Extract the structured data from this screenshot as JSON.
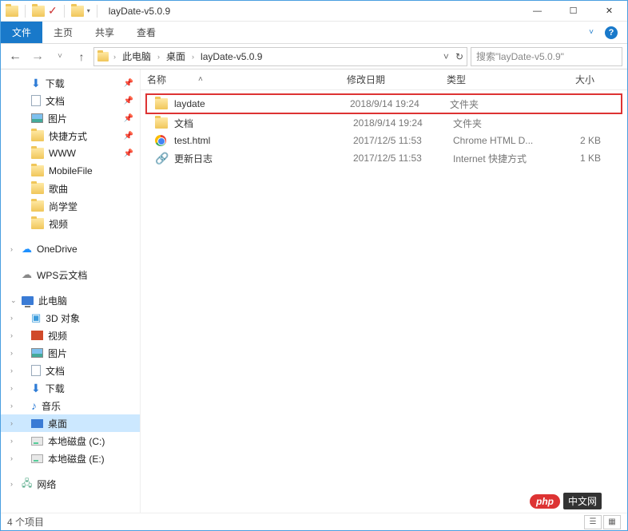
{
  "window": {
    "title": "layDate-v5.0.9"
  },
  "ribbon": {
    "file": "文件",
    "home": "主页",
    "share": "共享",
    "view": "查看"
  },
  "breadcrumb": {
    "pc": "此电脑",
    "desktop": "桌面",
    "folder": "layDate-v5.0.9"
  },
  "search": {
    "placeholder": "搜索\"layDate-v5.0.9\""
  },
  "columns": {
    "name": "名称",
    "date": "修改日期",
    "type": "类型",
    "size": "大小"
  },
  "files": [
    {
      "name": "laydate",
      "date": "2018/9/14 19:24",
      "type": "文件夹",
      "size": "",
      "icon": "folder",
      "highlight": true
    },
    {
      "name": "文档",
      "date": "2018/9/14 19:24",
      "type": "文件夹",
      "size": "",
      "icon": "folder"
    },
    {
      "name": "test.html",
      "date": "2017/12/5 11:53",
      "type": "Chrome HTML D...",
      "size": "2 KB",
      "icon": "chrome"
    },
    {
      "name": "更新日志",
      "date": "2017/12/5 11:53",
      "type": "Internet 快捷方式",
      "size": "1 KB",
      "icon": "link"
    }
  ],
  "sidebar": {
    "downloads": "下载",
    "documents": "文档",
    "pictures": "图片",
    "shortcuts": "快捷方式",
    "www": "WWW",
    "mobilefile": "MobileFile",
    "songs": "歌曲",
    "shang": "尚学堂",
    "videos": "视频",
    "onedrive": "OneDrive",
    "wps": "WPS云文档",
    "thispc": "此电脑",
    "obj3d": "3D 对象",
    "video2": "视频",
    "pictures2": "图片",
    "documents2": "文档",
    "downloads2": "下载",
    "music": "音乐",
    "desktop": "桌面",
    "diskc": "本地磁盘 (C:)",
    "diske": "本地磁盘 (E:)",
    "network": "网络"
  },
  "status": {
    "items": "4 个项目"
  },
  "watermark": {
    "badge": "php",
    "text": "中文网"
  }
}
